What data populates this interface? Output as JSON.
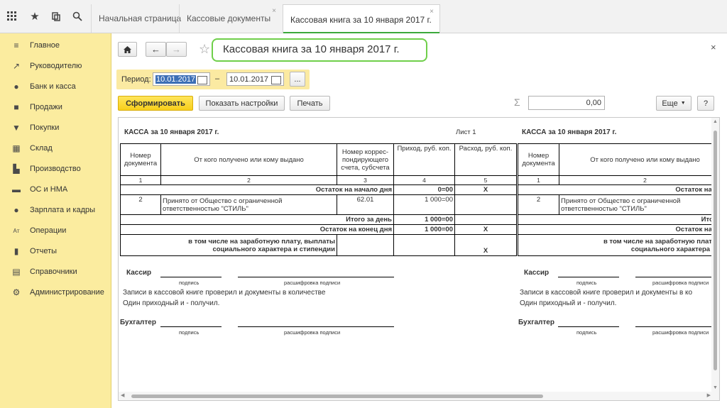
{
  "tabs": [
    "Начальная страница",
    "Кассовые документы",
    "Кассовая книга за 10 января 2017 г."
  ],
  "sidebar": {
    "items": [
      {
        "label": "Главное",
        "icon": "menu-lines-icon",
        "glyph": "≡"
      },
      {
        "label": "Руководителю",
        "icon": "trend-icon",
        "glyph": "↗"
      },
      {
        "label": "Банк и касса",
        "icon": "coin-icon",
        "glyph": "●"
      },
      {
        "label": "Продажи",
        "icon": "bag-icon",
        "glyph": "■"
      },
      {
        "label": "Покупки",
        "icon": "cart-icon",
        "glyph": "▼"
      },
      {
        "label": "Склад",
        "icon": "warehouse-icon",
        "glyph": "▦"
      },
      {
        "label": "Производство",
        "icon": "factory-icon",
        "glyph": "▙"
      },
      {
        "label": "ОС и НМА",
        "icon": "truck-icon",
        "glyph": "▬"
      },
      {
        "label": "Зарплата и кадры",
        "icon": "person-icon",
        "glyph": "●"
      },
      {
        "label": "Операции",
        "icon": "operations-icon",
        "glyph": "Aт"
      },
      {
        "label": "Отчеты",
        "icon": "bar-chart-icon",
        "glyph": "▮"
      },
      {
        "label": "Справочники",
        "icon": "books-icon",
        "glyph": "▤"
      },
      {
        "label": "Администрирование",
        "icon": "gear-icon",
        "glyph": "⚙"
      }
    ]
  },
  "form": {
    "title": "Кассовая книга за 10 января 2017 г.",
    "period_label": "Период:",
    "date_from": "10.01.2017",
    "date_to": "10.01.2017",
    "dash": "–",
    "more": "...",
    "generate": "Сформировать",
    "show_settings": "Показать настройки",
    "print": "Печать",
    "sum_value": "0,00",
    "more_menu": "Еще",
    "help": "?",
    "sigma": "Σ"
  },
  "report": {
    "header_left": "КАССА за 10 января 2017 г.",
    "sheet": "Лист 1",
    "header_right": "КАССА за 10 января 2017 г.",
    "columns": [
      "Номер документа",
      "От кого получено или кому выдано",
      "Номер коррес- пондирующего счета, субсчета",
      "Приход, руб. коп.",
      "Расход, руб. коп."
    ],
    "col_numbers": [
      "1",
      "2",
      "3",
      "4",
      "5"
    ],
    "opening_label": "Остаток на начало дня",
    "opening_in": "0=00",
    "opening_out": "X",
    "row_num": "2",
    "row_from_1": "Принято от Общество с ограниченной",
    "row_from_2": "ответственностью \"СТИЛЬ\"",
    "row_acct": "62.01",
    "row_in": "1 000=00",
    "day_total_label": "Итого за день",
    "day_total_in": "1 000=00",
    "closing_label": "Остаток на конец  дня",
    "closing_in": "1 000=00",
    "closing_out": "X",
    "incl_1": "в том числе на заработную плату, выплаты",
    "incl_2": "социального характера и стипендии",
    "incl_out": "X",
    "right_opening": "Остаток на нача",
    "right_total": "Итого за",
    "right_closing": "Остаток на коне",
    "right_incl_1": "в том числе на заработную плату, вы",
    "right_incl_2": "социального характера и сти",
    "right_col2": "От кого получено или кому выдано",
    "cashier": "Кассир",
    "signature": "подпись",
    "decode": "расшифровка подписи",
    "checked_1": "Записи в кассовой книге проверил и документы в количестве",
    "checked_2": "Один приходный и  -  получил.",
    "checked_1_right": "Записи в кассовой книге проверил и документы в ко",
    "accountant": "Бухгалтер"
  }
}
